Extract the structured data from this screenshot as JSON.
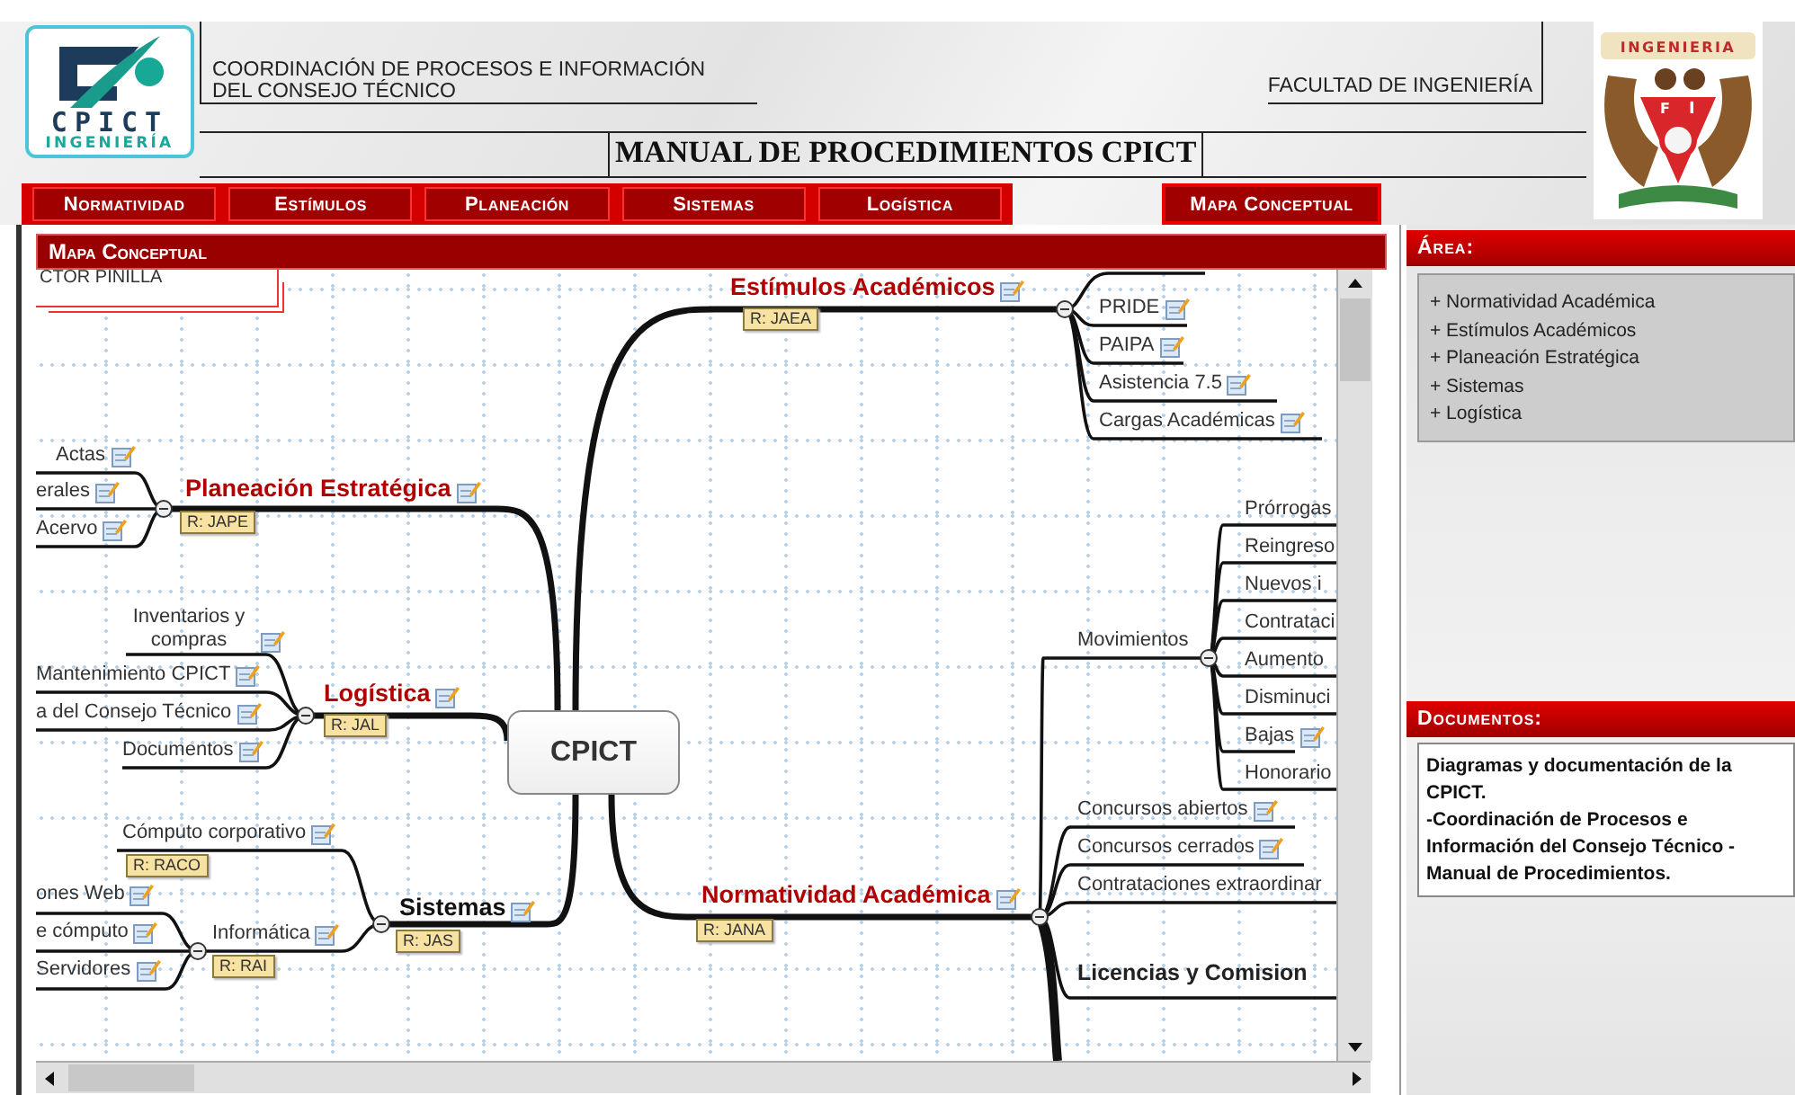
{
  "header": {
    "logo_mark": "CPICT",
    "logo_subtitle": "INGENIERÍA",
    "org_lines": [
      "COORDINACIÓN DE PROCESOS E INFORMACIÓN",
      "DEL CONSEJO TÉCNICO"
    ],
    "faculty": "FACULTAD DE INGENIERÍA",
    "title": "MANUAL DE PROCEDIMIENTOS CPICT",
    "crest_ribbon": "INGENIERIA",
    "crest_letters": [
      "F",
      "I"
    ]
  },
  "nav": [
    "Normatividad",
    "Estímulos",
    "Planeación",
    "Sistemas",
    "Logística"
  ],
  "map_button": "Mapa Conceptual",
  "map_panel": {
    "title": "Mapa Conceptual"
  },
  "mind_map": {
    "overlay_text": "CTOR PINILLA",
    "center": "CPICT",
    "branches": [
      {
        "label": "Estímulos Académicos",
        "tag": "R: JAEA",
        "children": [
          {
            "label": "PRIDE"
          },
          {
            "label": "PAIPA"
          },
          {
            "label": "Asistencia 7.5"
          },
          {
            "label": "Cargas Académicas"
          }
        ]
      },
      {
        "label": "Planeación Estratégica",
        "tag": "R: JAPE",
        "children": [
          {
            "label": "Actas"
          },
          {
            "label": "erales"
          },
          {
            "label": "Acervo"
          }
        ]
      },
      {
        "label": "Logística",
        "tag": "R: JAL",
        "children": [
          {
            "label": "Inventarios y compras"
          },
          {
            "label": "Mantenimiento CPICT"
          },
          {
            "label": "a del Consejo Técnico"
          },
          {
            "label": "Documentos"
          }
        ]
      },
      {
        "label": "Sistemas",
        "tag": "R: JAS",
        "children": [
          {
            "label": "Cómputo corporativo",
            "tag": "R: RACO"
          },
          {
            "label": "Informática",
            "tag": "R: RAI",
            "children": [
              {
                "label": "ones Web"
              },
              {
                "label": "e cómputo"
              },
              {
                "label": "Servidores"
              }
            ]
          }
        ]
      },
      {
        "label": "Normatividad Académica",
        "tag": "R: JANA",
        "children": [
          {
            "label": "Movimientos",
            "children": [
              {
                "label": "Prórrogas"
              },
              {
                "label": "Reingreso"
              },
              {
                "label": "Nuevos i"
              },
              {
                "label": "Contrataci"
              },
              {
                "label": "Aumento"
              },
              {
                "label": "Disminuci"
              },
              {
                "label": "Bajas"
              },
              {
                "label": "Honorario"
              }
            ]
          },
          {
            "label": "Concursos abiertos"
          },
          {
            "label": "Concursos cerrados"
          },
          {
            "label": "Contrataciones extraordinar"
          },
          {
            "label": "Licencias y Comision"
          }
        ]
      }
    ]
  },
  "area": {
    "title": "Área:",
    "items": [
      "+ Normatividad Académica",
      "+ Estímulos Académicos",
      "+ Planeación Estratégica",
      "+ Sistemas",
      "+ Logística"
    ]
  },
  "documents": {
    "title": "Documentos:",
    "paragraphs": [
      "Diagramas y documentación de la CPICT.",
      "-Coordinación de Procesos e Información del Consejo Técnico - Manual de Procedimientos."
    ]
  }
}
